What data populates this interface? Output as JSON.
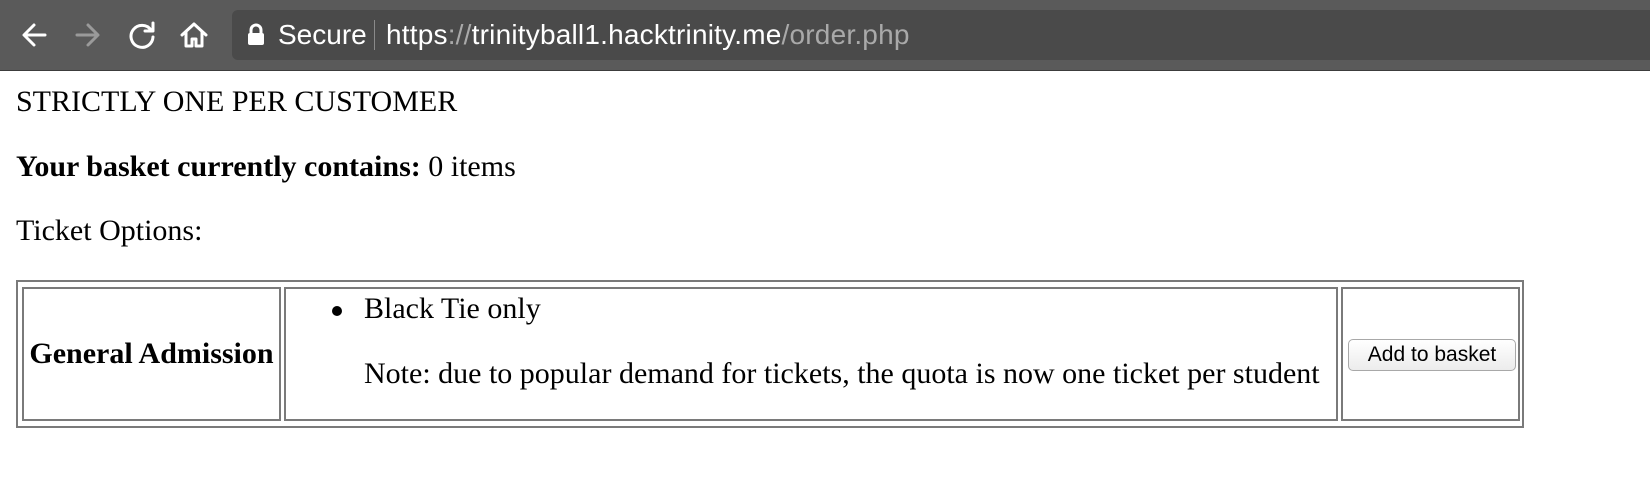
{
  "browser": {
    "secure_label": "Secure",
    "url": {
      "scheme": "https",
      "separator": "://",
      "host": "trinityball1.hacktrinity.me",
      "path": "/order.php"
    },
    "icons": [
      "back-arrow-icon",
      "forward-arrow-icon",
      "reload-icon",
      "home-icon",
      "lock-icon"
    ]
  },
  "page": {
    "notice": "STRICTLY ONE PER CUSTOMER",
    "basket_label": "Your basket currently contains:",
    "basket_value": "0 items",
    "options_heading": "Ticket Options:",
    "tickets": [
      {
        "name": "General Admission",
        "item": "Black Tie only",
        "note": "Note: due to popular demand for tickets, the quota is now one ticket per student",
        "button": "Add to basket"
      }
    ]
  }
}
